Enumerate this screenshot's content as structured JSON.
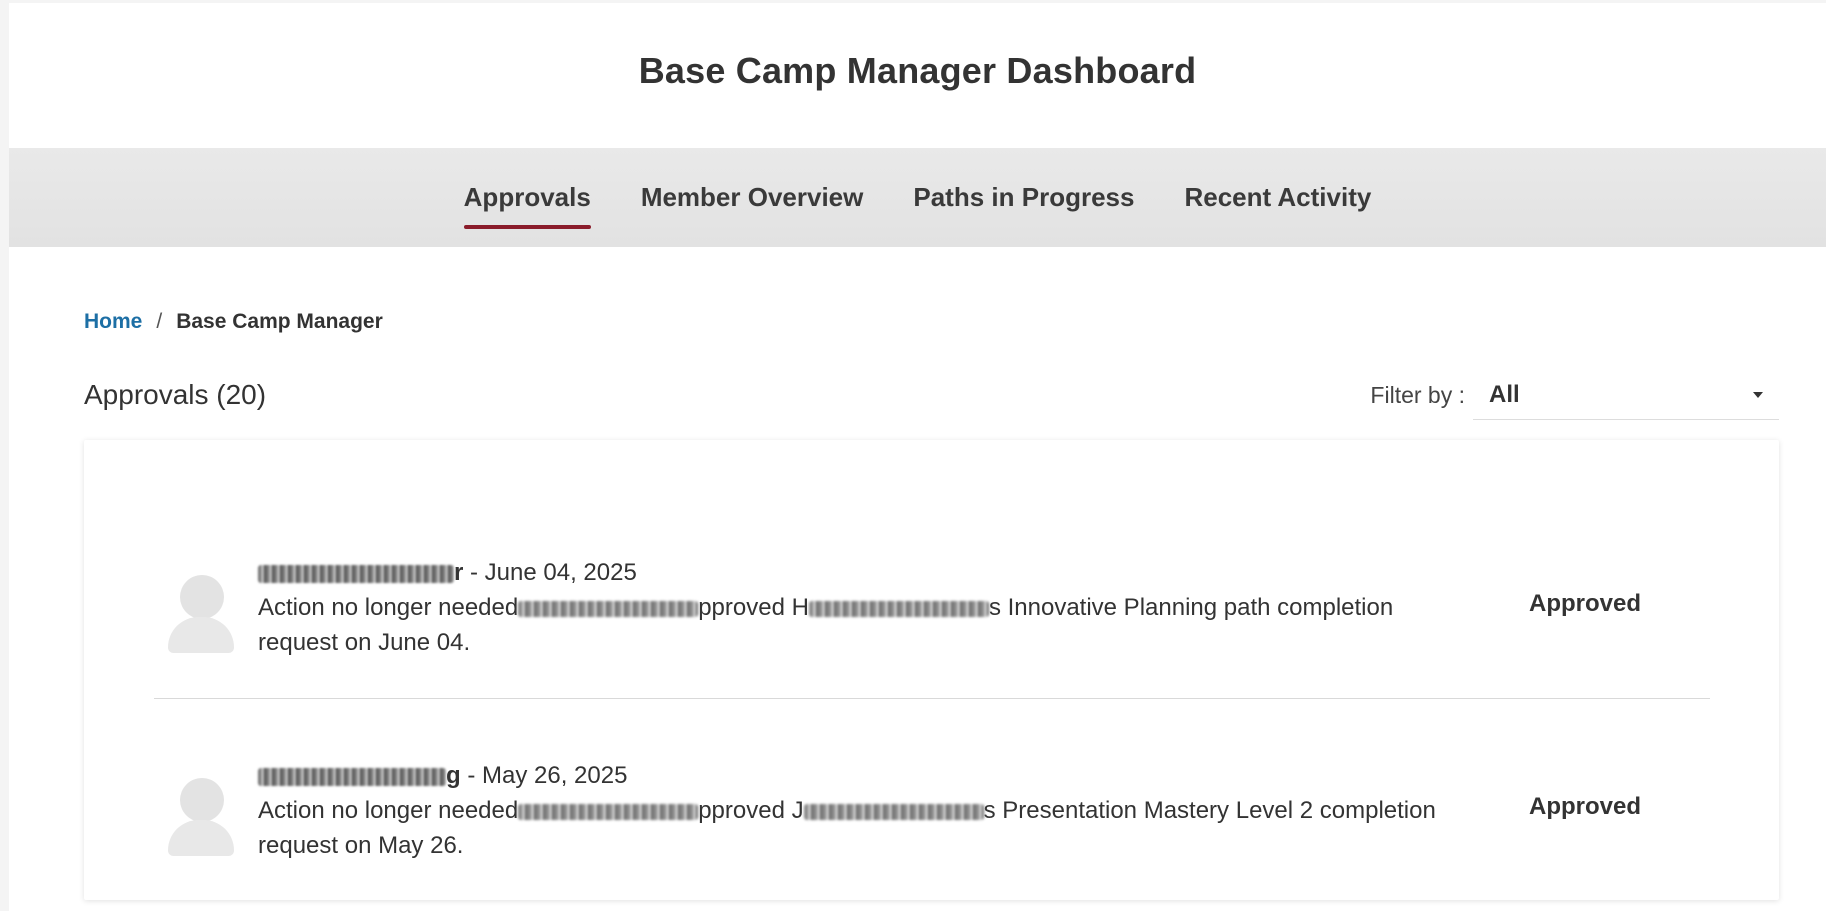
{
  "page_title": "Base Camp Manager Dashboard",
  "tabs": [
    {
      "label": "Approvals",
      "active": true
    },
    {
      "label": "Member Overview",
      "active": false
    },
    {
      "label": "Paths in Progress",
      "active": false
    },
    {
      "label": "Recent Activity",
      "active": false
    }
  ],
  "breadcrumb": {
    "home": "Home",
    "separator": "/",
    "current": "Base Camp Manager"
  },
  "approvals": {
    "heading": "Approvals (20)",
    "filter_label": "Filter by :",
    "filter_value": "All",
    "items": [
      {
        "name_suffix": "r",
        "date": " - June 04, 2025",
        "line_start": "Action no longer needed",
        "line_mid": "pproved H",
        "line_end": "s Innovative Planning path completion request on June 04.",
        "status": "Approved"
      },
      {
        "name_suffix": "g",
        "date": " - May 26, 2025",
        "line_start": "Action no longer needed",
        "line_mid": "pproved J",
        "line_end": "s Presentation Mastery Level 2 completion request on May 26.",
        "status": "Approved"
      }
    ]
  },
  "colors": {
    "accent": "#8a1c2b",
    "link": "#1d6fa5"
  }
}
